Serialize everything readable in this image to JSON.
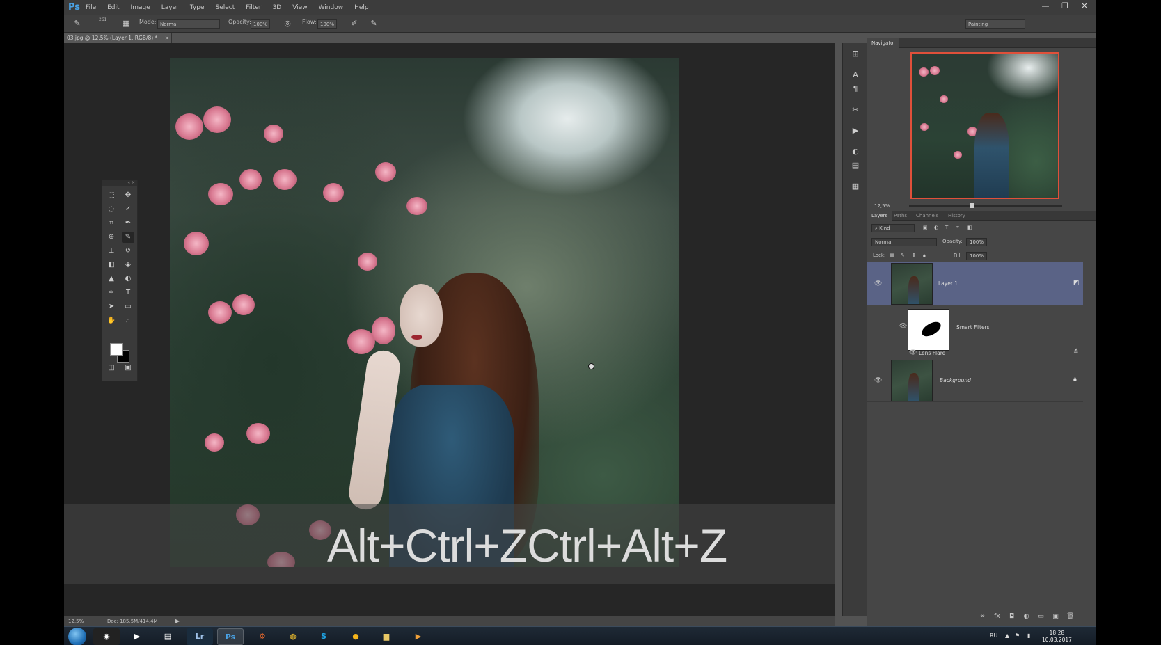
{
  "app": {
    "logo": "Ps",
    "menu": [
      "File",
      "Edit",
      "Image",
      "Layer",
      "Type",
      "Select",
      "Filter",
      "3D",
      "View",
      "Window",
      "Help"
    ],
    "window_controls": [
      "—",
      "❐",
      "✕"
    ]
  },
  "options_bar": {
    "brush_size": "261",
    "mode_label": "Mode:",
    "mode_value": "Normal",
    "opacity_label": "Opacity:",
    "opacity_value": "100%",
    "flow_label": "Flow:",
    "flow_value": "100%",
    "workspace": "Painting"
  },
  "document": {
    "tab_title": "03.jpg @ 12,5% (Layer 1, RGB/8) *",
    "tab_close": "×",
    "caption_overlay": "Alt+Ctrl+ZCtrl+Alt+Z"
  },
  "status_bar": {
    "zoom": "12,5%",
    "doc_size": "Doc: 185,5M/414,4M",
    "arrow": "▶"
  },
  "navigator": {
    "tab": "Navigator",
    "zoom": "12,5%"
  },
  "layers_panel": {
    "tabs": [
      "Layers",
      "Paths",
      "Channels",
      "History"
    ],
    "filter_kind": "Kind",
    "blend_mode": "Normal",
    "opacity_label": "Opacity:",
    "opacity_value": "100%",
    "lock_label": "Lock:",
    "fill_label": "Fill:",
    "fill_value": "100%",
    "layers": [
      {
        "name": "Layer 1",
        "selected": true
      },
      {
        "name": "Smart Filters",
        "selected": false
      },
      {
        "name": "Lens Flare",
        "selected": false
      },
      {
        "name": "Background",
        "selected": false
      }
    ]
  },
  "taskbar": {
    "apps": [
      "Lr",
      "Ps",
      "S"
    ],
    "language": "RU",
    "time": "18:28",
    "date": "10.03.2017"
  },
  "colors": {
    "accent_selection": "#5a6386",
    "navigator_frame": "#e0503a",
    "ps_logo": "#4aa3e6"
  }
}
